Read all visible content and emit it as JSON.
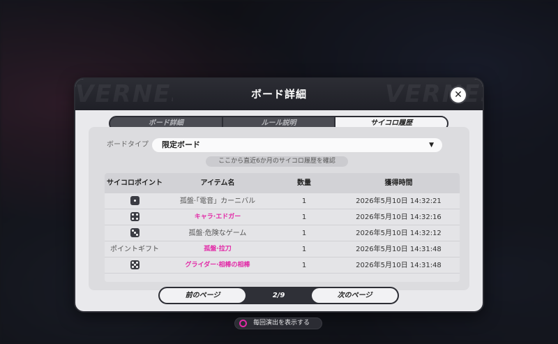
{
  "dialog": {
    "title": "ボード詳細",
    "close_icon": "close-icon"
  },
  "tabs": [
    {
      "label": "ボード詳細",
      "active": false
    },
    {
      "label": "ルール説明",
      "active": false
    },
    {
      "label": "サイコロ履歴",
      "active": true
    }
  ],
  "filter": {
    "label": "ボードタイプ",
    "selected": "限定ボード",
    "arrow_icon": "triangle-down-icon"
  },
  "hint": "ここから直近6か月のサイコロ履歴を確認",
  "table": {
    "headers": [
      "サイコロポイント",
      "アイテム名",
      "数量",
      "獲得時間"
    ],
    "rows": [
      {
        "point": "",
        "point_icon": "die-1-icon",
        "item": "孤盤·「電音」カーニバル",
        "highlight": false,
        "qty": "1",
        "time": "2026年5月10日 14:32:21"
      },
      {
        "point": "",
        "point_icon": "die-4-icon",
        "item": "キャラ·エドガー",
        "highlight": true,
        "qty": "1",
        "time": "2026年5月10日 14:32:16"
      },
      {
        "point": "",
        "point_icon": "die-3-icon",
        "item": "孤盤·危険なゲーム",
        "highlight": false,
        "qty": "1",
        "time": "2026年5月10日 14:32:12"
      },
      {
        "point": "ポイントギフト",
        "point_icon": "",
        "item": "孤盤·拉刀",
        "highlight": true,
        "qty": "1",
        "time": "2026年5月10日 14:31:48"
      },
      {
        "point": "",
        "point_icon": "die-5-icon",
        "item": "グライダー·相棒の相棒",
        "highlight": true,
        "qty": "1",
        "time": "2026年5月10日 14:31:48"
      }
    ]
  },
  "pager": {
    "prev": "前のページ",
    "page": "2/9",
    "next": "次のページ"
  },
  "toggle": {
    "label": "毎回演出を表示する"
  },
  "colors": {
    "accent": "#e22aa7",
    "header_bg": "#1f2027",
    "panel_bg": "#dcdcdf"
  }
}
